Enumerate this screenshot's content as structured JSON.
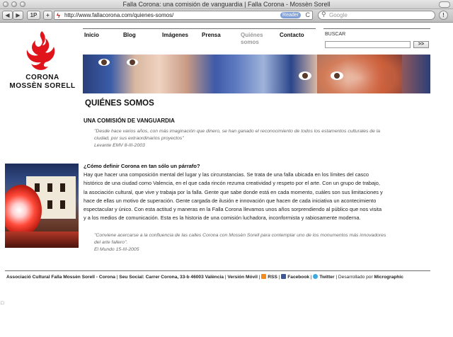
{
  "window": {
    "title": "Falla Corona: una comisión de vanguardia | Falla Corona - Mossèn Sorell"
  },
  "toolbar": {
    "back": "◀",
    "forward": "▶",
    "topsites": "1P",
    "add": "+",
    "url": "http://www.fallacorona.com/quienes-somos/",
    "reader": "Reader",
    "reload": "C",
    "search_placeholder": "Google",
    "info": "!"
  },
  "logo": {
    "line1": "CORONA",
    "line2": "MOSSÈN SORELL",
    "color": "#e0141b"
  },
  "nav": {
    "items": [
      {
        "label": "Inicio"
      },
      {
        "label": "Blog"
      },
      {
        "label": "Imágenes"
      },
      {
        "label": "Prensa"
      },
      {
        "label": "Quiénes somos"
      },
      {
        "label": "Contacto"
      }
    ],
    "search_label": "BUSCAR",
    "search_button": ">>"
  },
  "content": {
    "title": "QUIÉNES SOMOS",
    "subtitle": "UNA COMISIÓN DE VANGUARDIA",
    "quote1": {
      "line1": "\"Desde hace varios años, con más imaginación que dinero, se han ganado el reconocimiento de todos los estamentos culturales de la",
      "line2": "ciudad, por sus extraordinarios proyectos\"",
      "source": "Levante EMV 8-III-2003"
    },
    "question": "¿Cómo definir Corona en tan sólo un párrafo?",
    "paragraph_lines": [
      "Hay que hacer una composición mental del lugar y las circunstancias. Se trata de una falla ubicada en los límites del casco",
      "histórico de una ciudad como Valencia, en el que cada rincón rezuma creatividad y respeto por el arte. Con un grupo de trabajo,",
      "la asociación cultural, que vive y trabaja por la falla. Gente que sabe donde está en cada momento, cuáles son sus limitaciones y",
      "hace de ellas un motivo de superación. Gente cargada de ilusión e innovación que hacen de cada iniciativa un acontecimiento",
      "espectacular y único. Con esta actitud y maneras en la Falla Corona llevamos unos años sorprendiendo al público que nos visita",
      "y a los medios de comunicación. Esta es la historia de una comisión luchadora, inconformista y rabiosamente moderna."
    ],
    "quote2": {
      "line1": "\"Conviene acercarse a la confluencia de las calles Corona con Mossèn Sorell para contemplar uno de los monumentos más innovadores",
      "line2": "del arte fallero\".",
      "source": "El Mundo 15-III-2005"
    }
  },
  "footer": {
    "org": "Associació Cultural Falla Mossèn Sorell - Corona",
    "sep1": " | ",
    "address": "Seu Social: Carrer Corona, 33-b 46003 València",
    "sep2": " | ",
    "mobile": "Versión Móvil",
    "sep3": " | ",
    "rss": "RSS",
    "sep4": " | ",
    "facebook": "Facebook",
    "sep5": " | ",
    "twitter": "Twitter",
    "dev_prefix": " | Desarrollado por ",
    "dev": "Micrographic"
  },
  "colors": {
    "brand_red": "#e0141b",
    "rss_orange": "#f28a1e",
    "facebook_blue": "#3b5998",
    "twitter_blue": "#3fa9e0"
  }
}
